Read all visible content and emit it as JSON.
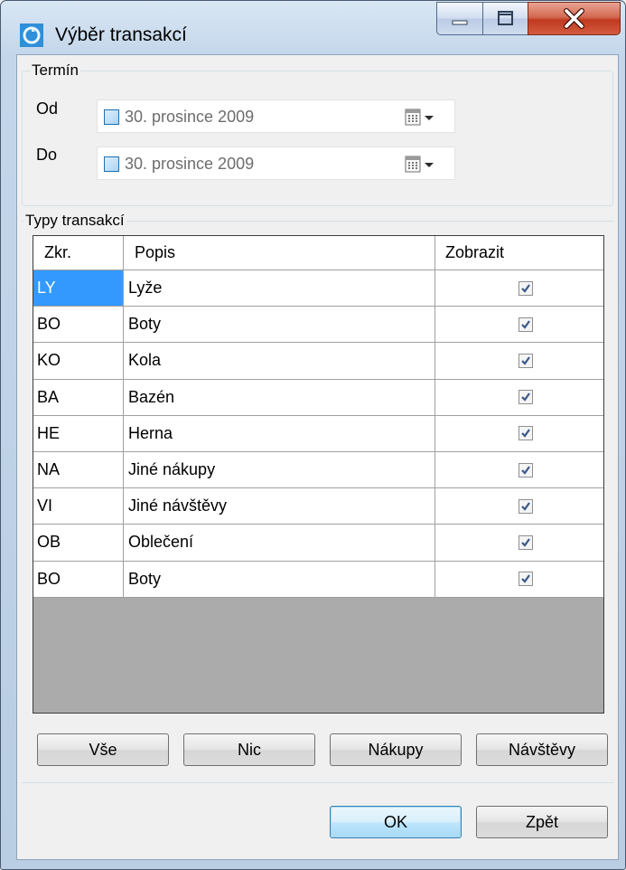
{
  "window": {
    "title": "Výběr transakcí",
    "icon": "app-icon",
    "controls": [
      "minimize-icon",
      "maximize-icon",
      "close-icon"
    ]
  },
  "term": {
    "legend": "Termín",
    "from_label": "Od",
    "to_label": "Do",
    "from_date": "30. prosince  2009",
    "to_date": "30. prosince  2009"
  },
  "types": {
    "legend": "Typy transakcí",
    "columns": [
      "Zkr.",
      "Popis",
      "Zobrazit"
    ],
    "rows": [
      {
        "code": "LY",
        "desc": "Lyže",
        "show": true
      },
      {
        "code": "BO",
        "desc": "Boty",
        "show": true
      },
      {
        "code": "KO",
        "desc": "Kola",
        "show": true
      },
      {
        "code": "BA",
        "desc": "Bazén",
        "show": true
      },
      {
        "code": "HE",
        "desc": "Herna",
        "show": true
      },
      {
        "code": "NA",
        "desc": "Jiné nákupy",
        "show": true
      },
      {
        "code": "VI",
        "desc": "Jiné návštěvy",
        "show": true
      },
      {
        "code": "OB",
        "desc": "Oblečení",
        "show": true
      },
      {
        "code": "BO",
        "desc": "Boty",
        "show": true
      }
    ],
    "buttons": {
      "all": "Vše",
      "none": "Nic",
      "purchases": "Nákupy",
      "visits": "Návštěvy"
    }
  },
  "footer": {
    "ok": "OK",
    "back": "Zpět"
  },
  "colors": {
    "selection": "#3399ff",
    "grid_empty": "#ababab"
  }
}
